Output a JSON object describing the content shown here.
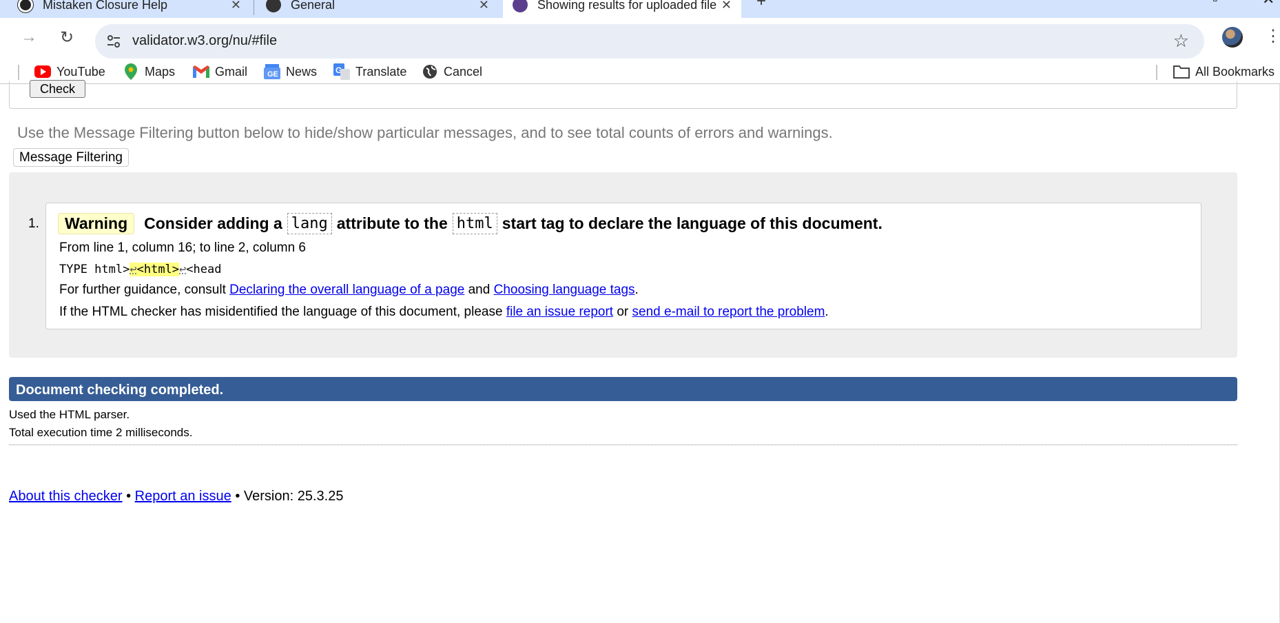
{
  "browser": {
    "tabs": [
      {
        "title": "Mistaken Closure Help"
      },
      {
        "title": "General"
      },
      {
        "title": "Showing results for uploaded file"
      }
    ],
    "url": "validator.w3.org/nu/#file",
    "bookmarks": [
      {
        "label": "YouTube",
        "icon": "youtube-icon"
      },
      {
        "label": "Maps",
        "icon": "maps-icon"
      },
      {
        "label": "Gmail",
        "icon": "gmail-icon"
      },
      {
        "label": "News",
        "icon": "news-icon"
      },
      {
        "label": "Translate",
        "icon": "translate-icon"
      },
      {
        "label": "Cancel",
        "icon": "globe-icon"
      }
    ],
    "all_bookmarks": "All Bookmarks"
  },
  "form": {
    "check_label": "Check"
  },
  "hint": "Use the Message Filtering button below to hide/show particular messages, and to see total counts of errors and warnings.",
  "filter_button": "Message Filtering",
  "message": {
    "number": "1.",
    "type": "Warning",
    "text_1": "Consider adding a",
    "code_1": "lang",
    "text_2": "attribute to the",
    "code_2": "html",
    "text_3": "start tag to declare the language of this document.",
    "location": "From line 1, column 16; to line 2, column 6",
    "extract_before": "TYPE html>",
    "extract_hl_lf": "↩",
    "extract_hl": "<html>",
    "extract_lf": "↩",
    "extract_after": "<head",
    "guidance_prefix": "For further guidance, consult",
    "guidance_link_1": "Declaring the overall language of a page",
    "guidance_and": "and",
    "guidance_link_2": "Choosing language tags",
    "guidance_end": ".",
    "misid_prefix": "If the HTML checker has misidentified the language of this document, please",
    "misid_link_1": "file an issue report",
    "misid_or": "or",
    "misid_link_2": "send e-mail to report the problem",
    "misid_end": "."
  },
  "status": {
    "completed": "Document checking completed.",
    "parser": "Used the HTML parser.",
    "time": "Total execution time 2 milliseconds."
  },
  "footer": {
    "about": "About this checker",
    "sep": "•",
    "report": "Report an issue",
    "version": "Version: 25.3.25"
  },
  "colors": {
    "tabstrip": "#d3e3fd",
    "done_bar": "#365d95",
    "warning_badge": "#ffffcc",
    "link": "#0000ee"
  }
}
